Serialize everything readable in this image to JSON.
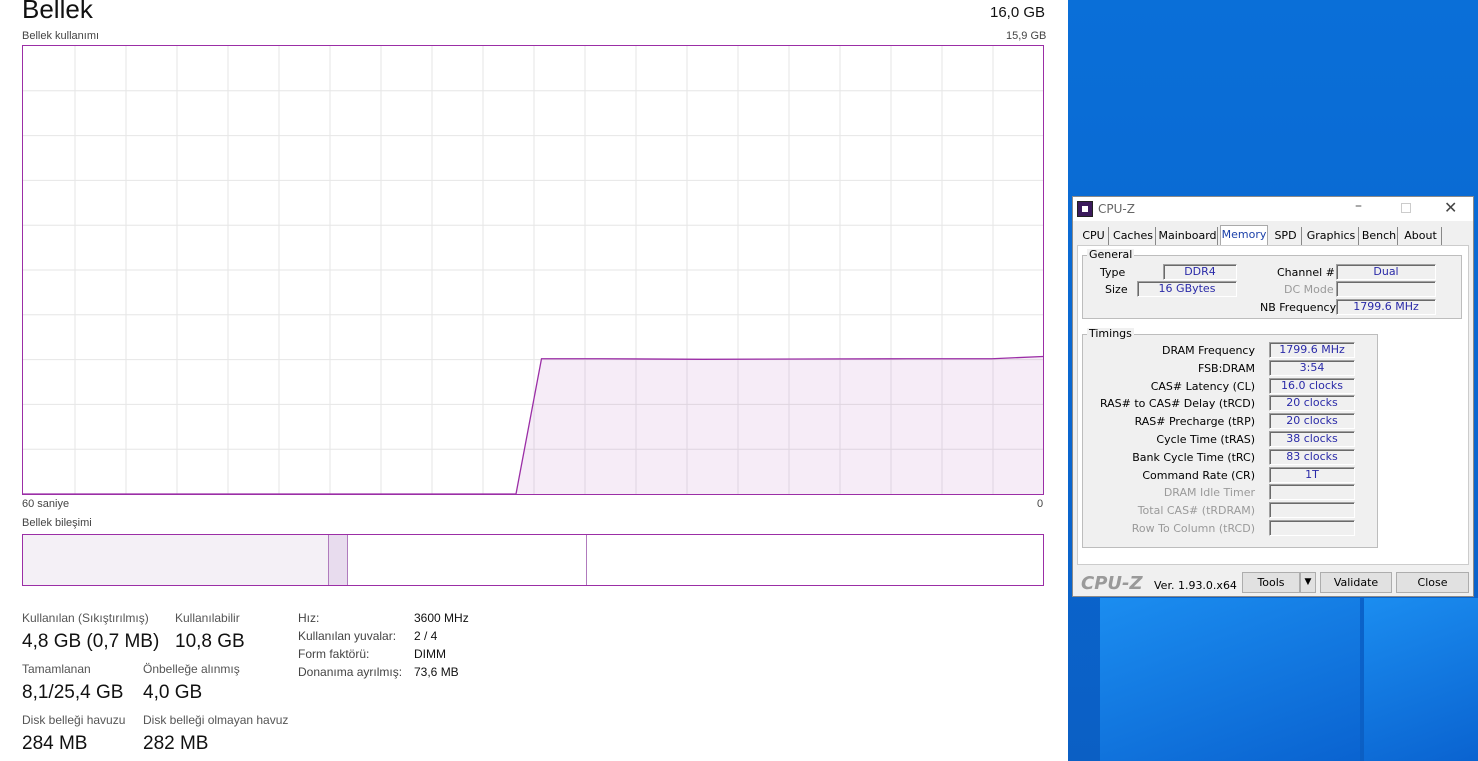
{
  "taskmanager": {
    "title": "Bellek",
    "total": "16,0 GB",
    "usage_label": "Bellek kullanımı",
    "usage_max": "15,9 GB",
    "axis_left": "60 saniye",
    "axis_right": "0",
    "composition_label": "Bellek bileşimi",
    "stats": {
      "in_use_label": "Kullanılan (Sıkıştırılmış)",
      "in_use_value": "4,8 GB (0,7 MB)",
      "available_label": "Kullanılabilir",
      "available_value": "10,8 GB",
      "committed_label": "Tamamlanan",
      "committed_value": "8,1/25,4 GB",
      "cached_label": "Önbelleğe alınmış",
      "cached_value": "4,0 GB",
      "paged_label": "Disk belleği havuzu",
      "paged_value": "284 MB",
      "nonpaged_label": "Disk belleği olmayan havuz",
      "nonpaged_value": "282 MB"
    },
    "info": {
      "speed_label": "Hız:",
      "speed_value": "3600 MHz",
      "slots_label": "Kullanılan yuvalar:",
      "slots_value": "2 / 4",
      "form_label": "Form faktörü:",
      "form_value": "DIMM",
      "reserved_label": "Donanıma ayrılmış:",
      "reserved_value": "73,6 MB"
    },
    "accent_color": "#9b2ea6"
  },
  "chart_data": {
    "type": "area",
    "title": "Bellek kullanımı",
    "xlabel": "",
    "ylabel": "",
    "xlim": [
      60,
      0
    ],
    "ylim": [
      0,
      15.9
    ],
    "x": [
      60,
      31,
      29.5,
      26,
      20,
      14,
      8,
      3,
      0
    ],
    "series": [
      {
        "values": [
          0,
          0,
          4.8,
          4.8,
          4.78,
          4.79,
          4.8,
          4.8,
          4.88
        ]
      }
    ],
    "grid": true
  },
  "composition": {
    "in_use_fraction": 0.3,
    "modified_fraction": 0.019,
    "standby_fraction": 0.234,
    "free_fraction": 0.447
  },
  "cpuz": {
    "title": "CPU-Z",
    "tabs": [
      "CPU",
      "Caches",
      "Mainboard",
      "Memory",
      "SPD",
      "Graphics",
      "Bench",
      "About"
    ],
    "active_tab": "Memory",
    "general_label": "General",
    "type_label": "Type",
    "type_value": "DDR4",
    "size_label": "Size",
    "size_value": "16 GBytes",
    "channel_label": "Channel #",
    "channel_value": "Dual",
    "dcmode_label": "DC Mode",
    "dcmode_value": "",
    "nbfreq_label": "NB Frequency",
    "nbfreq_value": "1799.6 MHz",
    "timings_label": "Timings",
    "timings": [
      {
        "label": "DRAM Frequency",
        "value": "1799.6 MHz",
        "dim": false
      },
      {
        "label": "FSB:DRAM",
        "value": "3:54",
        "dim": false
      },
      {
        "label": "CAS# Latency (CL)",
        "value": "16.0 clocks",
        "dim": false
      },
      {
        "label": "RAS# to CAS# Delay (tRCD)",
        "value": "20 clocks",
        "dim": false
      },
      {
        "label": "RAS# Precharge (tRP)",
        "value": "20 clocks",
        "dim": false
      },
      {
        "label": "Cycle Time (tRAS)",
        "value": "38 clocks",
        "dim": false
      },
      {
        "label": "Bank Cycle Time (tRC)",
        "value": "83 clocks",
        "dim": false
      },
      {
        "label": "Command Rate (CR)",
        "value": "1T",
        "dim": false
      },
      {
        "label": "DRAM Idle Timer",
        "value": "",
        "dim": true
      },
      {
        "label": "Total CAS# (tRDRAM)",
        "value": "",
        "dim": true
      },
      {
        "label": "Row To Column (tRCD)",
        "value": "",
        "dim": true
      }
    ],
    "brand": "CPU-Z",
    "version": "Ver. 1.93.0.x64",
    "tools_label": "Tools",
    "validate_label": "Validate",
    "close_label": "Close"
  }
}
